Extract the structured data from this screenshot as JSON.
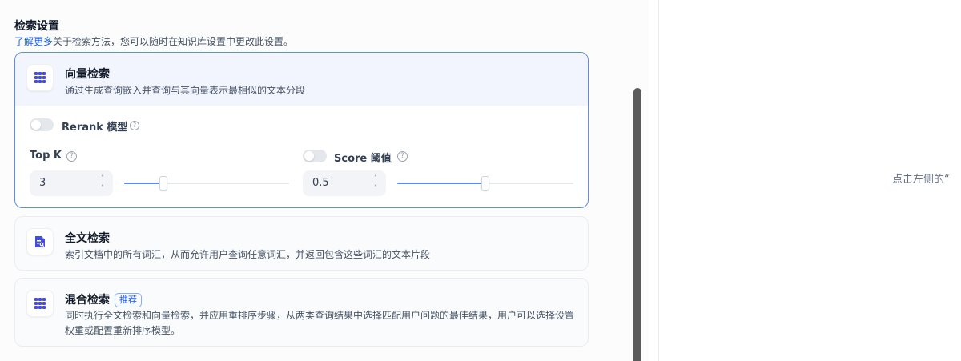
{
  "section": {
    "title": "检索设置",
    "desc_link": "了解更多",
    "desc_text": "关于检索方法，您可以随时在知识库设置中更改此设置。"
  },
  "vector": {
    "title": "向量检索",
    "desc": "通过生成查询嵌入并查询与其向量表示最相似的文本分段",
    "rerank_label": "Rerank 模型",
    "rerank_enabled": false,
    "topk_label": "Top K",
    "topk_value": "3",
    "topk_fraction": 0.24,
    "score_label": "Score 阈值",
    "score_enabled": false,
    "score_value": "0.5",
    "score_fraction": 0.5
  },
  "fulltext": {
    "title": "全文检索",
    "desc": "索引文档中的所有词汇，从而允许用户查询任意词汇，并返回包含这些词汇的文本片段"
  },
  "hybrid": {
    "title": "混合检索",
    "badge": "推荐",
    "desc": "同时执行全文检索和向量检索，并应用重排序步骤，从两类查询结果中选择匹配用户问题的最佳结果，用户可以选择设置权重或配置重新排序模型。"
  },
  "right_panel": {
    "hint": "点击左侧的“"
  },
  "icons": {
    "grid": "grid-dots-icon",
    "doc": "document-search-icon",
    "help": "help-circle-icon",
    "stepper": "chevron-up-down-icon"
  },
  "colors": {
    "accent": "#155eef",
    "icon": "#444ce7",
    "active_border": "#5b8def"
  }
}
